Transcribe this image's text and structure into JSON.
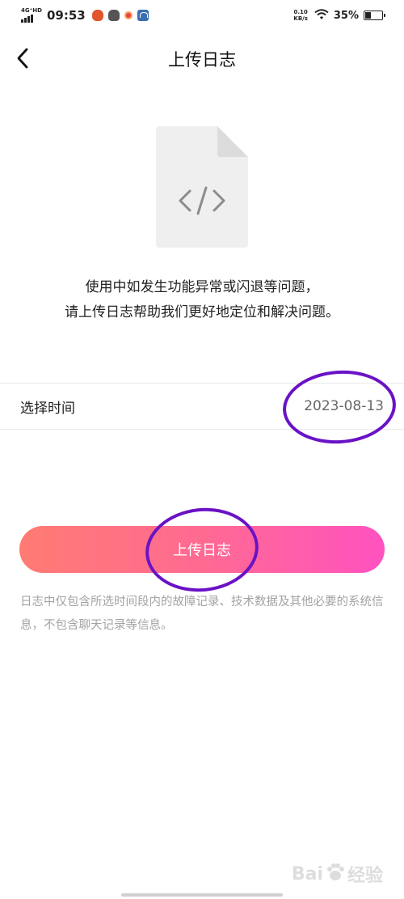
{
  "status_bar": {
    "network_type": "4G⁺HD",
    "time": "09:53",
    "net_speed_value": "0.10",
    "net_speed_unit": "KB/s",
    "battery_percent": "35%",
    "battery_level": 0.35
  },
  "nav": {
    "title": "上传日志"
  },
  "description": {
    "line1": "使用中如发生功能异常或闪退等问题，",
    "line2": "请上传日志帮助我们更好地定位和解决问题。"
  },
  "date_row": {
    "label": "选择时间",
    "value": "2023-08-13"
  },
  "upload_button": {
    "label": "上传日志"
  },
  "note": {
    "text": "日志中仅包含所选时间段内的故障记录、技术数据及其他必要的系统信息，不包含聊天记录等信息。"
  },
  "watermark": {
    "text_left": "Bai",
    "text_right": "经验"
  },
  "colors": {
    "button_gradient_start": "#ff7b73",
    "button_gradient_end": "#ff52c0",
    "annotation": "#6a12c6",
    "note_text": "#a3a3a3",
    "file_icon": "#efefef"
  },
  "icons": {
    "back": "chevron-left-icon",
    "file": "code-file-icon",
    "wifi": "wifi-icon",
    "battery": "battery-icon"
  }
}
